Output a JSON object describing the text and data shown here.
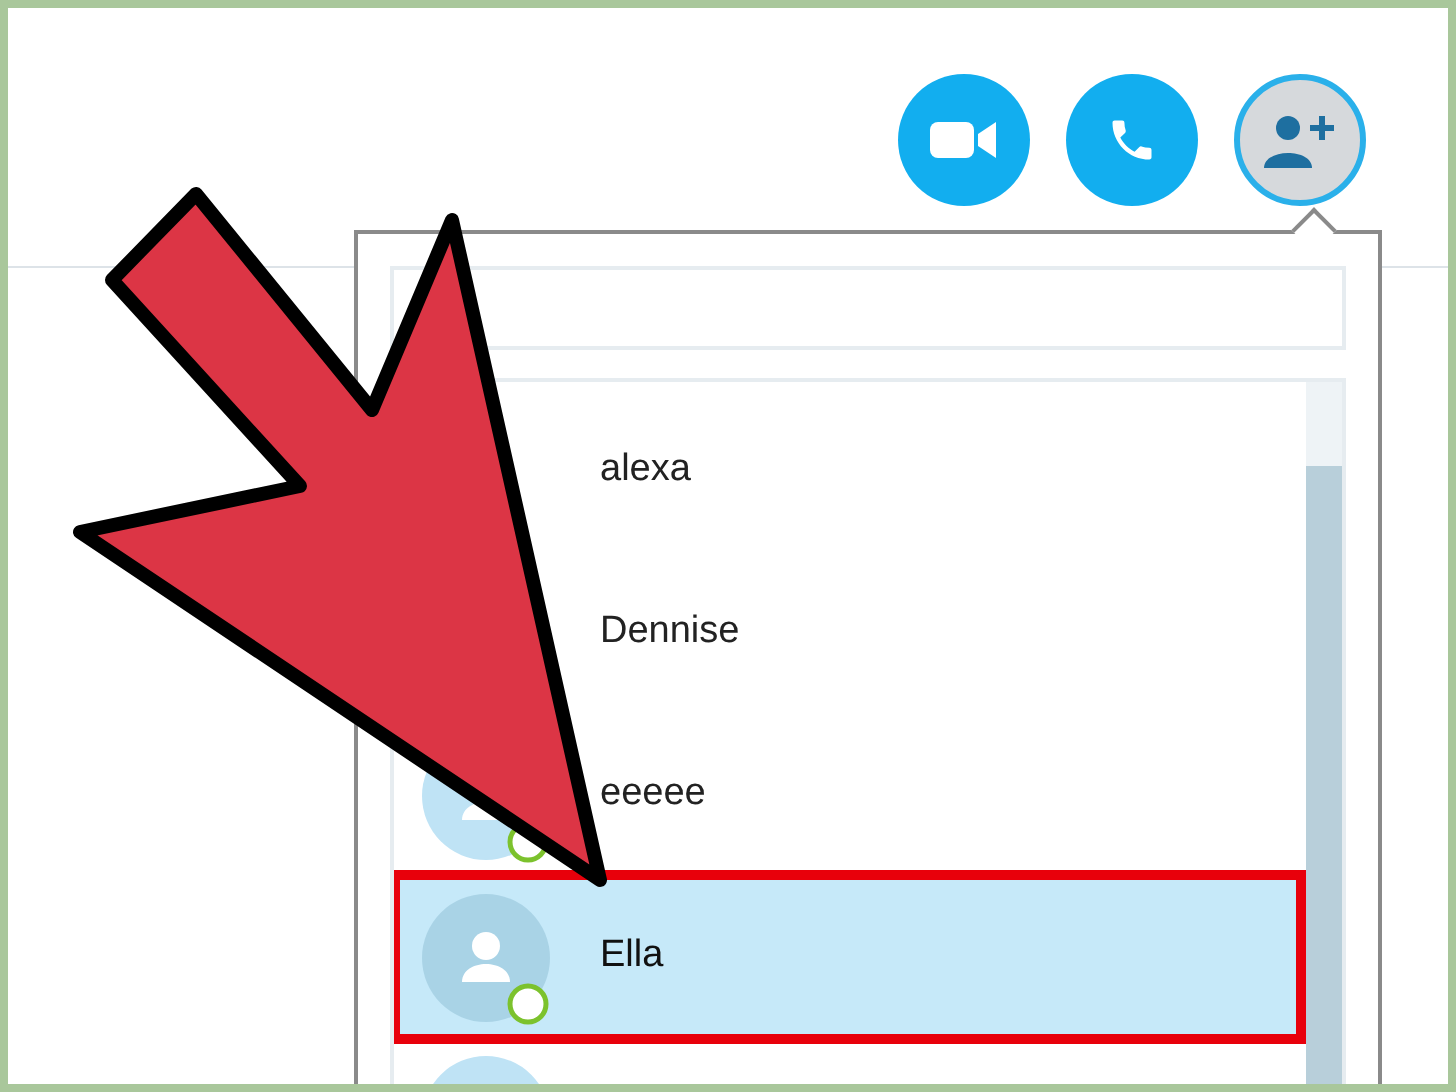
{
  "call_buttons": [
    {
      "kind": "video"
    },
    {
      "kind": "phone"
    },
    {
      "kind": "add_contact",
      "selected": true
    }
  ],
  "contacts": [
    {
      "name": "alexa",
      "selected": false
    },
    {
      "name": "Dennise",
      "selected": false
    },
    {
      "name": "eeeee",
      "selected": false,
      "online": true,
      "avatar": true
    },
    {
      "name": "Ella",
      "selected": true,
      "online": true,
      "avatar": true
    },
    {
      "selected": false,
      "avatar": true
    }
  ]
}
